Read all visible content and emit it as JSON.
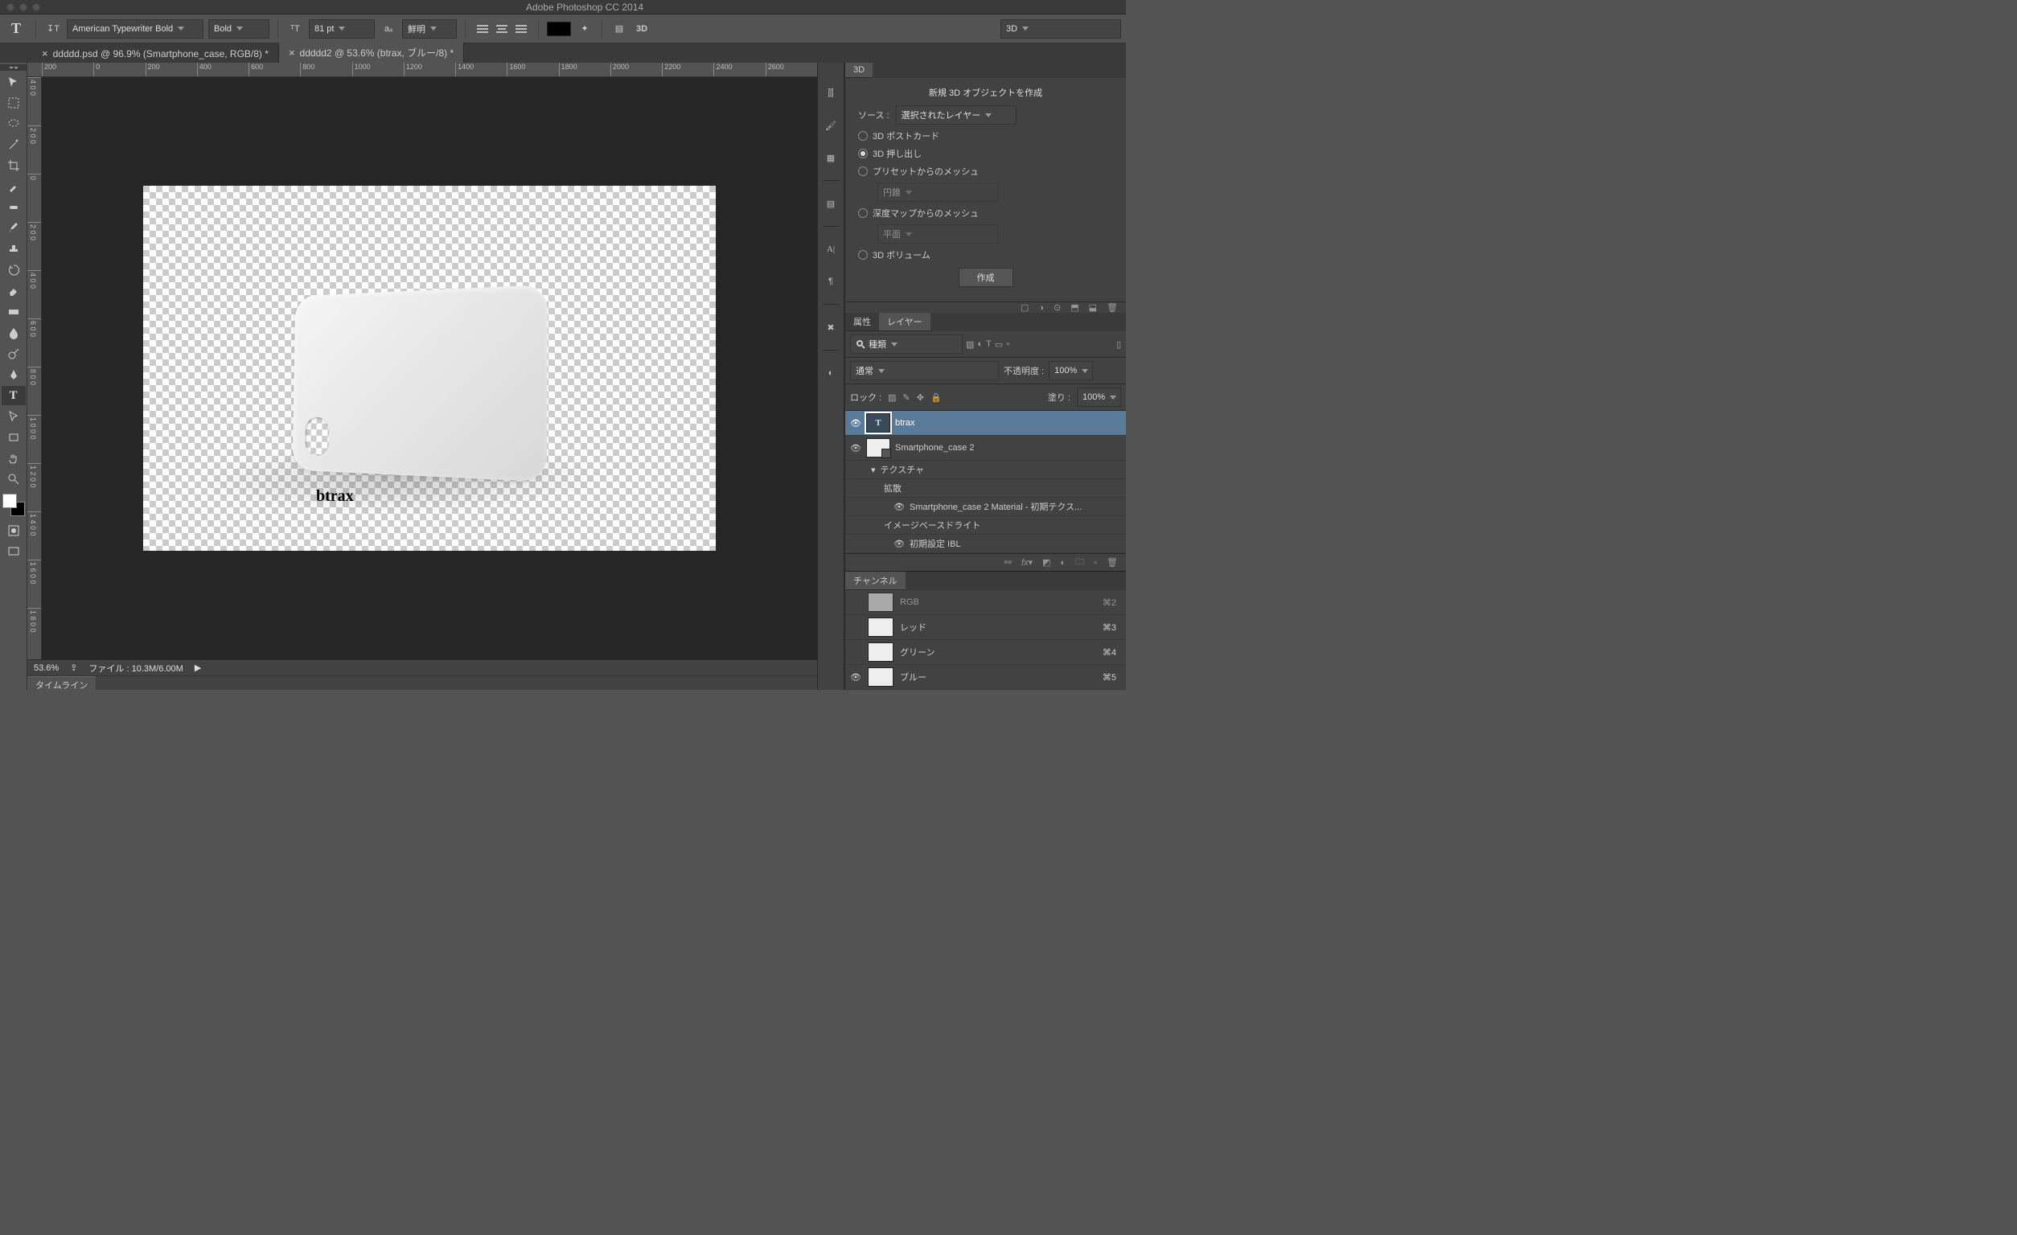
{
  "app": {
    "title": "Adobe Photoshop CC 2014"
  },
  "options": {
    "font_family": "American Typewriter Bold",
    "font_weight": "Bold",
    "font_size": "81 pt",
    "antialias": "鮮明",
    "mode_3d": "3D"
  },
  "tabs": [
    {
      "label": "ddddd.psd @ 96.9% (Smartphone_case, RGB/8) *",
      "active": false
    },
    {
      "label": "ddddd2 @ 53.6% (btrax, ブルー/8) *",
      "active": true
    }
  ],
  "ruler_h": [
    "200",
    "0",
    "200",
    "400",
    "600",
    "800",
    "1000",
    "1200",
    "1400",
    "1600",
    "1800",
    "2000",
    "2200",
    "2400",
    "2600"
  ],
  "ruler_v": [
    "4 0 0",
    "2 0 0",
    "0",
    "2 0 0",
    "4 0 0",
    "6 0 0",
    "8 0 0",
    "1 0 0 0",
    "1 2 0 0",
    "1 4 0 0",
    "1 6 0 0",
    "1 8 0 0"
  ],
  "canvas": {
    "text": "btrax"
  },
  "status": {
    "zoom": "53.6%",
    "file_label": "ファイル :",
    "file_info": "10.3M/6.00M"
  },
  "timeline": {
    "tab": "タイムライン"
  },
  "right_dropdown": "3D",
  "panel3d": {
    "tab": "3D",
    "heading": "新規 3D オブジェクトを作成",
    "source_label": "ソース :",
    "source_value": "選択されたレイヤー",
    "options": {
      "postcard": "3D ポストカード",
      "extrusion": "3D 押し出し",
      "preset": "プリセットからのメッシュ",
      "preset_val": "円錐",
      "depth": "深度マップからのメッシュ",
      "depth_val": "平面",
      "volume": "3D ボリューム"
    },
    "create": "作成"
  },
  "layers_panel": {
    "tab_attr": "属性",
    "tab_layers": "レイヤー",
    "kind": "種類",
    "blend": "通常",
    "opacity_label": "不透明度 :",
    "opacity": "100%",
    "lock_label": "ロック :",
    "fill_label": "塗り :",
    "fill": "100%",
    "items": [
      {
        "name": "btrax",
        "type": "text",
        "selected": true
      },
      {
        "name": "Smartphone_case 2",
        "type": "3d"
      },
      {
        "name": "テクスチャ",
        "sub": 1,
        "arrow": true
      },
      {
        "name": "拡散",
        "sub": 2
      },
      {
        "name": "Smartphone_case 2 Material - 初期テクス...",
        "sub": 3,
        "eye": true
      },
      {
        "name": "イメージベースドライト",
        "sub": 2
      },
      {
        "name": "初期設定 IBL",
        "sub": 3,
        "eye": true
      }
    ]
  },
  "channels": {
    "tab": "チャンネル",
    "items": [
      {
        "name": "RGB",
        "key": "⌘2",
        "vis": false
      },
      {
        "name": "レッド",
        "key": "⌘3",
        "vis": false
      },
      {
        "name": "グリーン",
        "key": "⌘4",
        "vis": false
      },
      {
        "name": "ブルー",
        "key": "⌘5",
        "vis": true
      }
    ]
  }
}
